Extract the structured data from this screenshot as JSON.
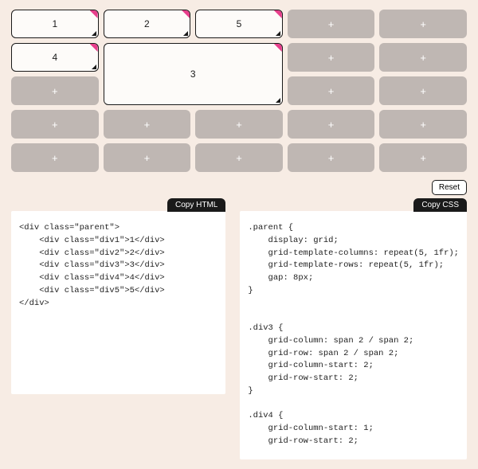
{
  "grid": {
    "placeholder": "+",
    "occupied": {
      "c1": "1",
      "c2": "2",
      "c5": "5",
      "c4": "4",
      "c3": "3"
    }
  },
  "buttons": {
    "reset": "Reset",
    "copy_html": "Copy HTML",
    "copy_css": "Copy CSS"
  },
  "code": {
    "html": "<div class=\"parent\">\n    <div class=\"div1\">1</div>\n    <div class=\"div2\">2</div>\n    <div class=\"div3\">3</div>\n    <div class=\"div4\">4</div>\n    <div class=\"div5\">5</div>\n</div>",
    "css": ".parent {\n    display: grid;\n    grid-template-columns: repeat(5, 1fr);\n    grid-template-rows: repeat(5, 1fr);\n    gap: 8px;\n}\n\n\n.div3 {\n    grid-column: span 2 / span 2;\n    grid-row: span 2 / span 2;\n    grid-column-start: 2;\n    grid-row-start: 2;\n}\n\n.div4 {\n    grid-column-start: 1;\n    grid-row-start: 2;"
  }
}
